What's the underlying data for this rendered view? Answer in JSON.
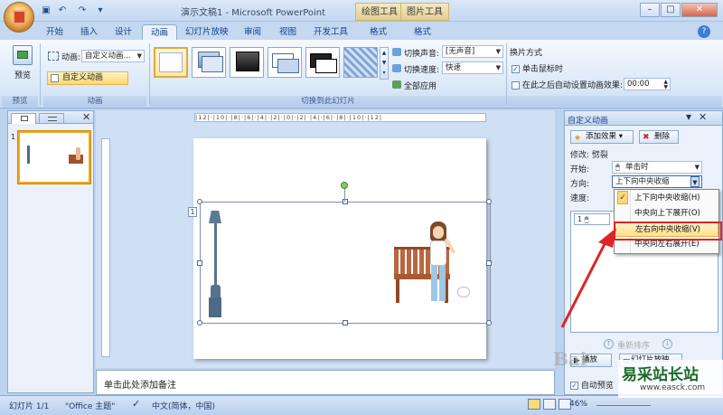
{
  "window": {
    "title": "演示文稿1 - Microsoft PowerPoint",
    "context_tabs": [
      "绘图工具",
      "图片工具"
    ]
  },
  "ribbon": {
    "tabs": [
      "开始",
      "插入",
      "设计",
      "动画",
      "幻灯片放映",
      "审阅",
      "视图",
      "开发工具",
      "格式",
      "格式"
    ],
    "active_tab": "动画",
    "preview": {
      "button_label": "预览",
      "group_label": "预览"
    },
    "animations": {
      "animation_label": "动画:",
      "animation_value": "自定义动画...",
      "custom_button": "自定义动画",
      "group_label": "动画"
    },
    "transitions": {
      "sound_label": "切换声音:",
      "sound_value": "[无声音]",
      "speed_label": "切换速度:",
      "speed_value": "快速",
      "apply_all": "全部应用",
      "group_label": "切换到此幻灯片"
    },
    "advance": {
      "title": "换片方式",
      "on_click": "单击鼠标时",
      "auto_label": "在此之后自动设置动画效果:",
      "auto_value": "00:00",
      "on_click_checked": true,
      "auto_checked": false
    }
  },
  "left_panel": {
    "slide_number": "1"
  },
  "slide": {
    "animation_tag": "1"
  },
  "notes": {
    "placeholder": "单击此处添加备注"
  },
  "task_pane": {
    "title": "自定义动画",
    "add_effect": "添加效果",
    "remove": "删除",
    "modify_label": "修改: 劈裂",
    "start_label": "开始:",
    "start_value": "单击时",
    "direction_label": "方向:",
    "direction_value": "上下向中央收缩",
    "speed_label": "速度:",
    "list_item_index": "1",
    "reorder_label": "重新排序",
    "play_label": "播放",
    "slideshow_label": "幻灯片放映",
    "autopreview_label": "自动预览"
  },
  "direction_menu": {
    "items": [
      "上下向中央收缩(H)",
      "中央向上下展开(O)",
      "左右向中央收缩(V)",
      "中央向左右展开(E)"
    ],
    "checked_index": 0,
    "highlighted_index": 2
  },
  "status": {
    "slide": "幻灯片 1/1",
    "theme": "\"Office 主题\"",
    "language": "中文(简体，中国)",
    "zoom": "46%"
  },
  "watermark": {
    "left": "Bai",
    "right_text": "易采站长站",
    "url": "www.easck.com"
  }
}
